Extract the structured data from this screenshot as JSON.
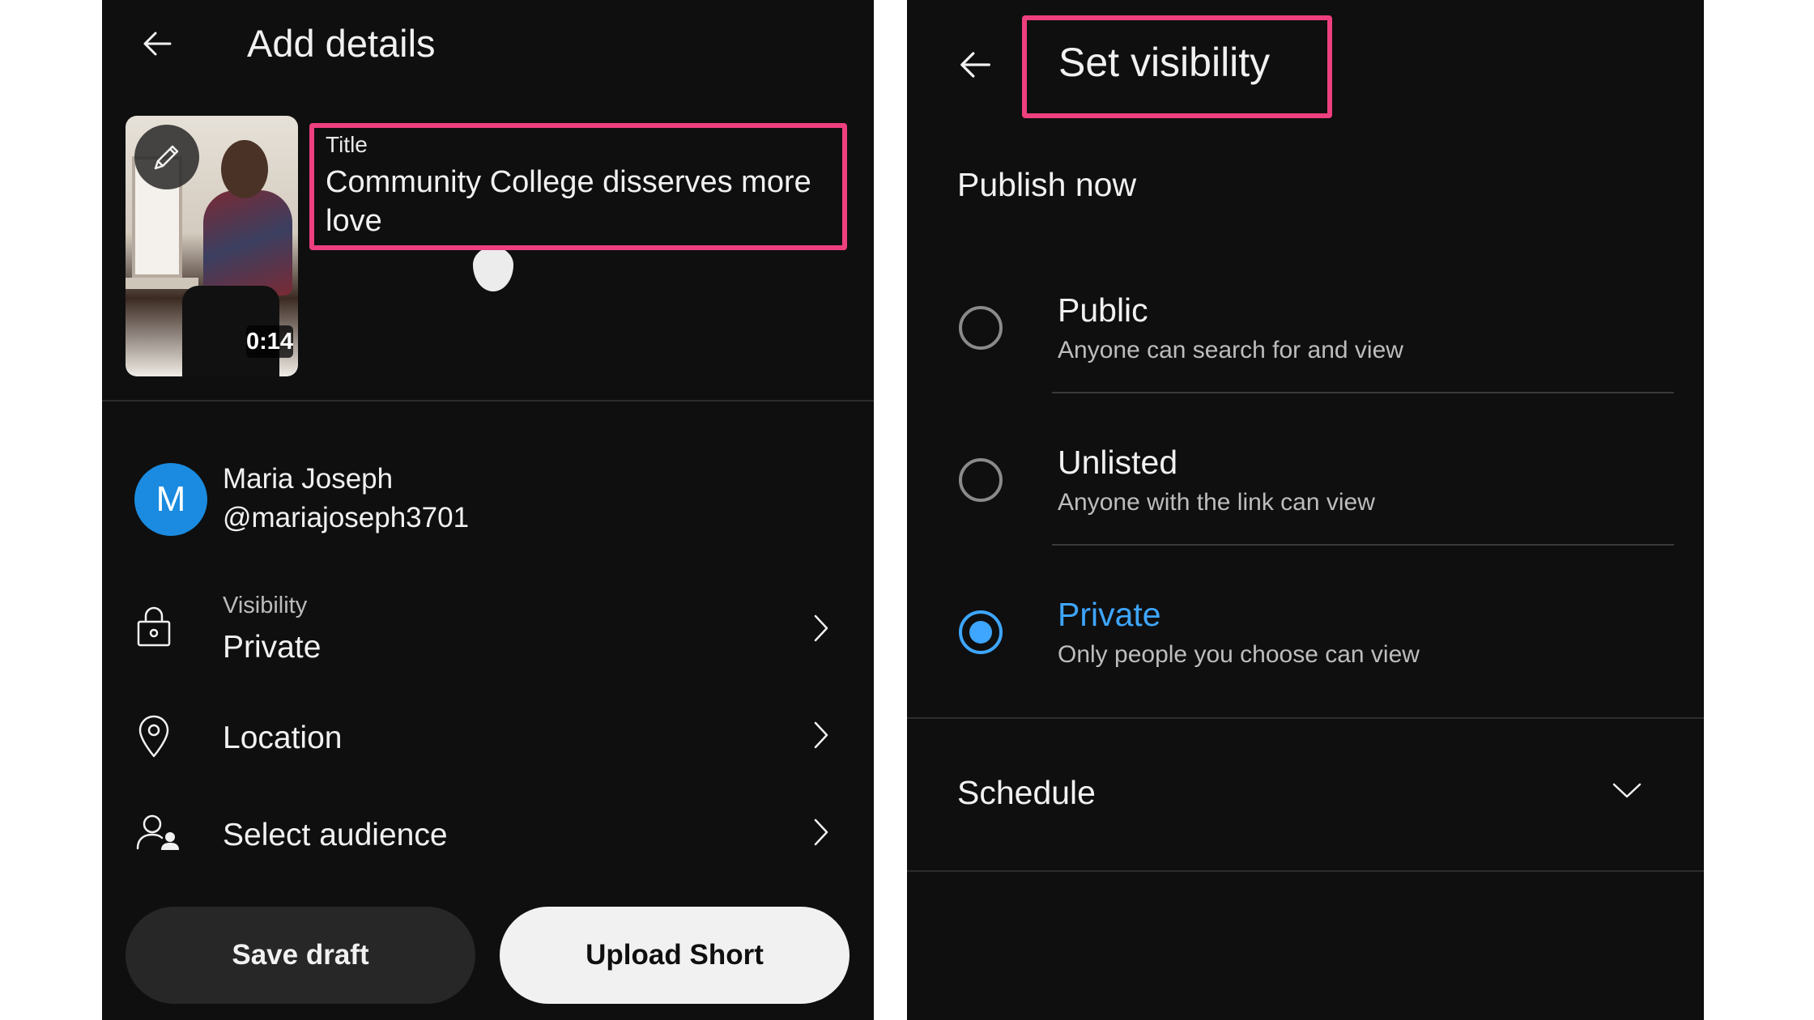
{
  "left_screen": {
    "header": {
      "title": "Add details"
    },
    "video": {
      "duration": "0:14"
    },
    "title_field": {
      "label": "Title",
      "value": "Community College disserves more love"
    },
    "account": {
      "initial": "M",
      "name": "Maria Joseph",
      "handle": "@mariajoseph3701"
    },
    "settings": [
      {
        "sub": "Visibility",
        "label": "Private",
        "icon": "lock-icon"
      },
      {
        "label": "Location",
        "icon": "location-pin-icon"
      },
      {
        "label": "Select audience",
        "icon": "audience-icon"
      }
    ],
    "buttons": {
      "save_draft": "Save draft",
      "upload": "Upload Short"
    }
  },
  "right_screen": {
    "header": {
      "title": "Set visibility"
    },
    "section": "Publish now",
    "options": [
      {
        "label": "Public",
        "description": "Anyone can search for and view",
        "selected": false
      },
      {
        "label": "Unlisted",
        "description": "Anyone with the link can view",
        "selected": false
      },
      {
        "label": "Private",
        "description": "Only people you choose can view",
        "selected": true
      }
    ],
    "schedule": {
      "label": "Schedule"
    }
  },
  "colors": {
    "background": "#0f0f0f",
    "accent": "#3ea6ff",
    "highlight": "#ee3f7e",
    "avatar": "#1a8be0"
  }
}
